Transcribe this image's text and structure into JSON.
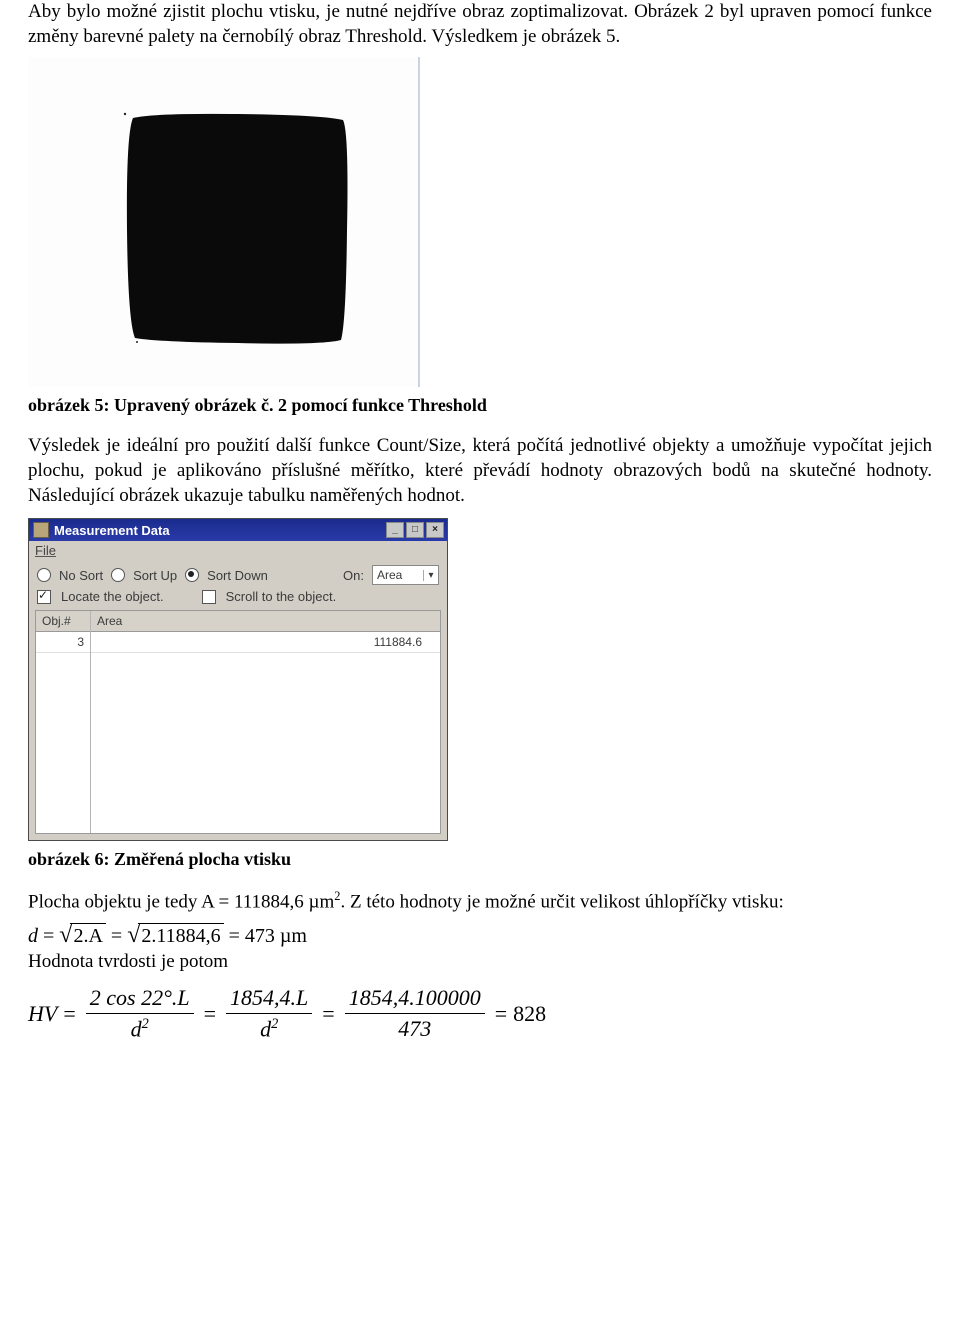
{
  "paragraphs": {
    "p1": "Aby bylo možné zjistit plochu vtisku, je nutné nejdříve obraz zoptimalizovat. Obrázek 2 byl upraven pomocí funkce změny barevné palety na černobílý obraz Threshold. Výsledkem je obrázek 5.",
    "caption5": "obrázek 5: Upravený obrázek č. 2 pomocí funkce Threshold",
    "p2": "Výsledek je ideální pro použití další funkce Count/Size, která počítá jednotlivé objekty a umožňuje vypočítat jejich plochu, pokud je aplikováno příslušné měřítko, které převádí hodnoty obrazových bodů na skutečné hodnoty. Následující obrázek ukazuje tabulku naměřených hodnot.",
    "caption6": "obrázek 6: Změřená plocha vtisku",
    "p3_a": "Plocha objektu je tedy A = 111884,6 µm",
    "p3_sup": "2",
    "p3_b": ". Z této hodnoty je možné určit velikost úhlopříčky vtisku:",
    "p4": "Hodnota tvrdosti je potom"
  },
  "measurement_window": {
    "title": "Measurement Data",
    "menu_file": "File",
    "sort": {
      "no_sort": "No Sort",
      "sort_up": "Sort Up",
      "sort_down": "Sort Down",
      "on_label": "On:",
      "on_value": "Area"
    },
    "opts": {
      "locate": "Locate the object.",
      "scroll": "Scroll to the object."
    },
    "headers": {
      "objnum": "Obj.#",
      "area": "Area"
    },
    "row": {
      "objnum": "3",
      "area": "111884.6"
    }
  },
  "formulas": {
    "d_lhs": "d",
    "d_sqrt1": "2.A",
    "d_sqrt2": "2.11884,6",
    "d_result": "473 µm",
    "hv_label": "HV",
    "frac1_num": "2 cos 22°.L",
    "frac1_den_base": "d",
    "frac1_den_exp": "2",
    "frac2_num": "1854,4.L",
    "frac2_den_base": "d",
    "frac2_den_exp": "2",
    "frac3_num": "1854,4.100000",
    "frac3_den": "473",
    "hv_result": "828"
  }
}
